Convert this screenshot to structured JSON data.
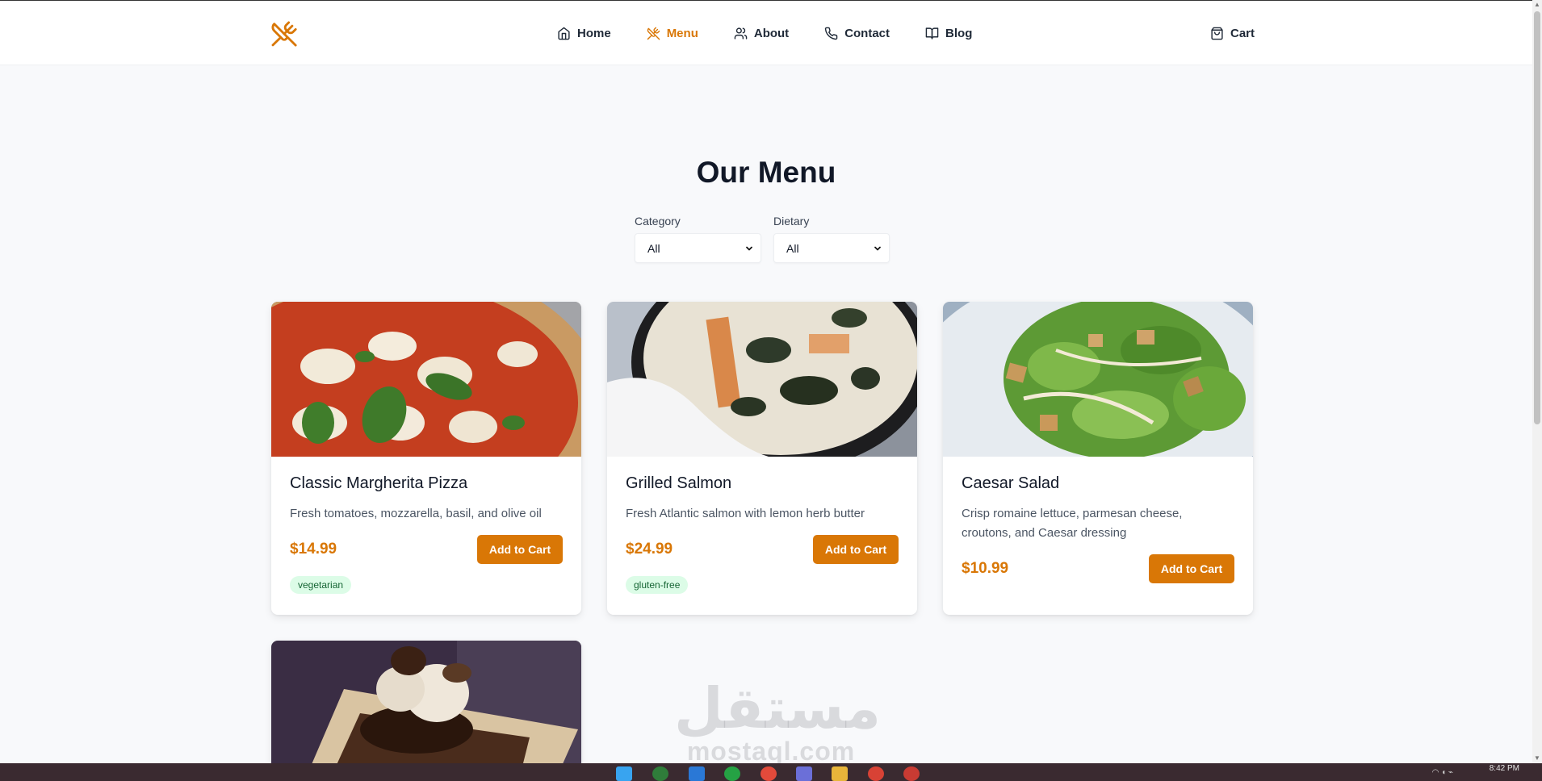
{
  "brand": {
    "logo_icon": "utensils-crossed-icon",
    "accent_color": "#d97706"
  },
  "nav": {
    "items": [
      {
        "label": "Home",
        "icon": "home-icon",
        "active": false
      },
      {
        "label": "Menu",
        "icon": "utensils-crossed-icon",
        "active": true
      },
      {
        "label": "About",
        "icon": "users-icon",
        "active": false
      },
      {
        "label": "Contact",
        "icon": "phone-icon",
        "active": false
      },
      {
        "label": "Blog",
        "icon": "book-open-icon",
        "active": false
      }
    ],
    "cart_label": "Cart"
  },
  "page": {
    "title": "Our Menu"
  },
  "filters": {
    "category": {
      "label": "Category",
      "value": "All"
    },
    "dietary": {
      "label": "Dietary",
      "value": "All"
    }
  },
  "menu_items": [
    {
      "name": "Classic Margherita Pizza",
      "description": "Fresh tomatoes, mozzarella, basil, and olive oil",
      "price": "$14.99",
      "button": "Add to Cart",
      "tag": "vegetarian"
    },
    {
      "name": "Grilled Salmon",
      "description": "Fresh Atlantic salmon with lemon herb butter",
      "price": "$24.99",
      "button": "Add to Cart",
      "tag": "gluten-free"
    },
    {
      "name": "Caesar Salad",
      "description": "Crisp romaine lettuce, parmesan cheese, croutons, and Caesar dressing",
      "price": "$10.99",
      "button": "Add to Cart"
    }
  ],
  "watermark": {
    "arabic": "مستقل",
    "latin": "mostaql.com"
  },
  "taskbar": {
    "time": "8:42 PM"
  }
}
